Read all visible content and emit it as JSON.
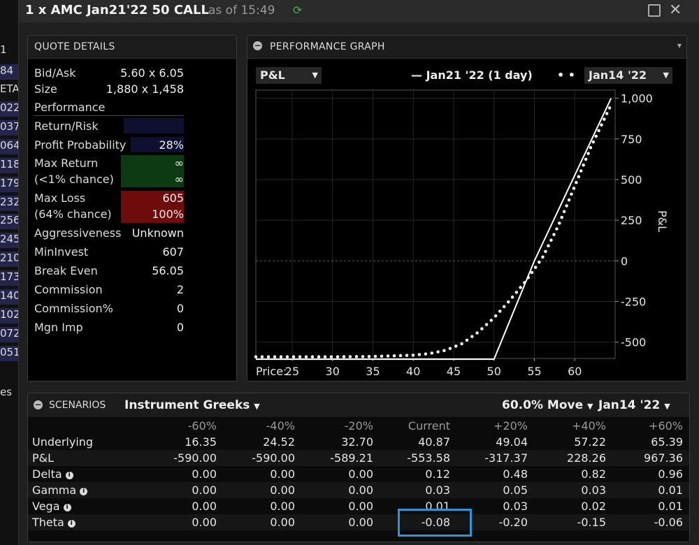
{
  "left_strip": {
    "rows": [
      {
        "text": "1",
        "hl": false
      },
      {
        "text": "84",
        "hl": true
      },
      {
        "text": "ETA",
        "hl": false
      },
      {
        "text": "022",
        "hl": true
      },
      {
        "text": "037",
        "hl": true
      },
      {
        "text": "064",
        "hl": true
      },
      {
        "text": "118",
        "hl": true
      },
      {
        "text": "179",
        "hl": true
      },
      {
        "text": "232",
        "hl": true
      },
      {
        "text": "256",
        "hl": true
      },
      {
        "text": "245",
        "hl": true
      },
      {
        "text": "210",
        "hl": true
      },
      {
        "text": "173",
        "hl": true
      },
      {
        "text": "140",
        "hl": true
      },
      {
        "text": "102",
        "hl": true
      },
      {
        "text": "072",
        "hl": true
      },
      {
        "text": "051",
        "hl": true
      },
      {
        "text": "es",
        "hl": false
      }
    ]
  },
  "title": {
    "instrument": "1 x AMC Jan21'22 50 CALL",
    "as_of": "as of 15:49"
  },
  "quote_details": {
    "header": "QUOTE DETAILS",
    "bid_ask_label": "Bid/Ask",
    "bid_ask_value": "5.60 x 6.05",
    "size_label": "Size",
    "size_value": "1,880 x 1,458",
    "performance_label": "Performance",
    "return_risk_label": "Return/Risk",
    "profit_prob_label": "Profit Probability",
    "profit_prob_value": "28%",
    "max_return_label": "Max Return",
    "max_return_value": "∞",
    "max_return_chance_label": "(<1% chance)",
    "max_return_chance_value": "∞",
    "max_loss_label": "Max Loss",
    "max_loss_value": "605",
    "max_loss_chance_label": "(64% chance)",
    "max_loss_chance_value": "100%",
    "aggressiveness_label": "Aggressiveness",
    "aggressiveness_value": "Unknown",
    "mininvest_label": "MinInvest",
    "mininvest_value": "607",
    "break_even_label": "Break Even",
    "break_even_value": "56.05",
    "commission_label": "Commission",
    "commission_value": "2",
    "commission_pct_label": "Commission%",
    "commission_pct_value": "0",
    "mgn_imp_label": "Mgn Imp",
    "mgn_imp_value": "0",
    "colors": {
      "return_risk": "#0f1030",
      "profit_prob": "#0f1030",
      "max_return": "#0c3a12",
      "max_loss": "#6e0c0c"
    }
  },
  "performance_graph": {
    "header": "PERFORMANCE GRAPH",
    "metric_dropdown": "P&L",
    "solid_legend": "— Jan21 '22 (1 day)",
    "dotted_legend_marker": "• •",
    "date_dropdown": "Jan14 '22"
  },
  "chart_data": {
    "type": "line",
    "ylabel": "P&L",
    "x_axis_prefix": "Price:",
    "xlim": [
      20.5,
      65
    ],
    "ylim": [
      -600,
      1050
    ],
    "x_ticks": [
      25,
      30,
      35,
      40,
      45,
      50,
      55,
      60
    ],
    "y_ticks": [
      1000,
      750,
      500,
      250,
      0,
      -250,
      -500
    ],
    "y_tick_labels": [
      "1,000",
      "750",
      "500",
      "250",
      "0",
      "-250",
      "-500"
    ],
    "series": [
      {
        "style": "solid",
        "x": [
          20.5,
          50,
          55,
          64.5
        ],
        "y": [
          -605,
          -605,
          0,
          1000
        ]
      },
      {
        "style": "dotted",
        "x": [
          20.5,
          30,
          35,
          40,
          42,
          44,
          46,
          48,
          50,
          52,
          54,
          56,
          58,
          60,
          62,
          64.5
        ],
        "y": [
          -590,
          -590,
          -588,
          -580,
          -570,
          -550,
          -510,
          -440,
          -350,
          -240,
          -120,
          20,
          220,
          460,
          700,
          960
        ]
      }
    ]
  },
  "scenarios": {
    "header": "SCENARIOS",
    "greeks_dropdown": "Instrument Greeks",
    "move_dropdown": "60.0% Move",
    "date_dropdown": "Jan14 '22",
    "columns": [
      "-60%",
      "-40%",
      "-20%",
      "Current",
      "+20%",
      "+40%",
      "+60%"
    ],
    "rows": [
      {
        "label": "Underlying",
        "info": false,
        "values": [
          "16.35",
          "24.52",
          "32.70",
          "40.87",
          "49.04",
          "57.22",
          "65.39"
        ]
      },
      {
        "label": "P&L",
        "info": false,
        "values": [
          "-590.00",
          "-590.00",
          "-589.21",
          "-553.58",
          "-317.37",
          "228.26",
          "967.36"
        ]
      },
      {
        "label": "Delta",
        "info": true,
        "values": [
          "0.00",
          "0.00",
          "0.00",
          "0.12",
          "0.48",
          "0.82",
          "0.96"
        ]
      },
      {
        "label": "Gamma",
        "info": true,
        "values": [
          "0.00",
          "0.00",
          "0.00",
          "0.03",
          "0.05",
          "0.03",
          "0.01"
        ]
      },
      {
        "label": "Vega",
        "info": true,
        "values": [
          "0.00",
          "0.00",
          "0.00",
          "0.01",
          "0.03",
          "0.02",
          "0.01"
        ]
      },
      {
        "label": "Theta",
        "info": true,
        "values": [
          "0.00",
          "0.00",
          "0.00",
          "-0.08",
          "-0.20",
          "-0.15",
          "-0.06"
        ]
      }
    ]
  },
  "colors": {
    "accent_highlight": "#2b95d6",
    "refresh": "#4caf50"
  }
}
